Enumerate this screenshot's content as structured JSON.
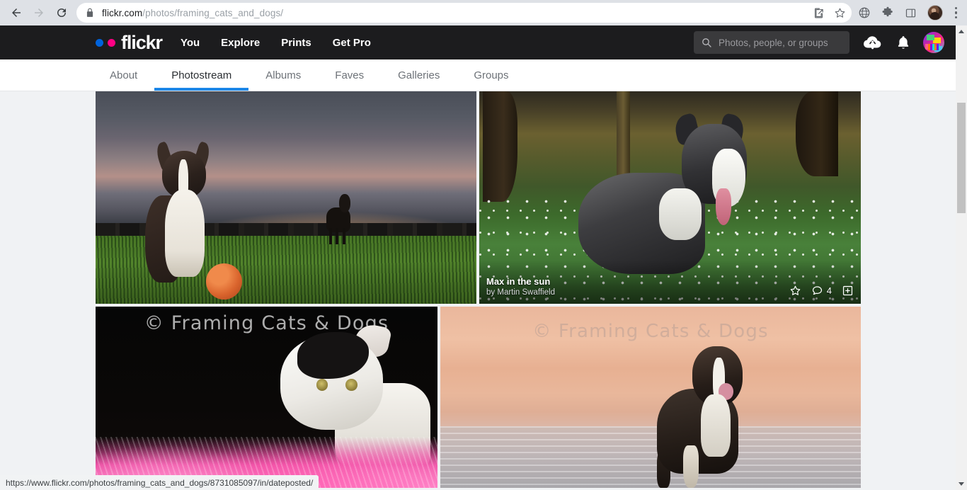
{
  "browser": {
    "back_icon": "back-arrow-icon",
    "forward_icon": "forward-arrow-icon",
    "reload_icon": "reload-icon",
    "lock_icon": "lock-icon",
    "url_host": "flickr.com",
    "url_path": "/photos/framing_cats_and_dogs/",
    "toolbar_icons": [
      "share-icon",
      "bookmark-star-icon",
      "globe-icon",
      "extensions-puzzle-icon",
      "side-panel-icon",
      "profile-avatar",
      "chrome-menu-icon"
    ],
    "status_bar_url": "https://www.flickr.com/photos/framing_cats_and_dogs/8731085097/in/dateposted/"
  },
  "flickr_header": {
    "logo_text": "flickr",
    "logo_dot_blue": "#0063dc",
    "logo_dot_pink": "#ff0084",
    "nav": [
      {
        "label": "You"
      },
      {
        "label": "Explore"
      },
      {
        "label": "Prints"
      },
      {
        "label": "Get Pro"
      }
    ],
    "search": {
      "placeholder": "Photos, people, or groups",
      "value": "",
      "icon": "search-icon"
    },
    "upload_icon": "cloud-upload-icon",
    "notifications_icon": "bell-icon",
    "avatar": "user-avatar"
  },
  "profile_tabs": {
    "active": "Photostream",
    "active_underline_color": "#1c87e8",
    "items": [
      {
        "label": "About"
      },
      {
        "label": "Photostream"
      },
      {
        "label": "Albums"
      },
      {
        "label": "Faves"
      },
      {
        "label": "Galleries"
      },
      {
        "label": "Groups"
      }
    ]
  },
  "photostream": {
    "watermark_text": "© Framing Cats & Dogs",
    "rows": [
      {
        "photos": [
          {
            "id": "sunset-collie",
            "alt": "Border collie sitting on grass at sunset with an orange ball, second dog in background",
            "has_overlay": false
          },
          {
            "id": "max-in-the-sun",
            "alt": "Black and white border collie lying in woodland among white wood anemone flowers",
            "has_overlay": true,
            "title": "Max in the sun",
            "author_prefix": "by",
            "author": "Martin Swaffield",
            "fave_icon": "star-outline-icon",
            "comment_icon": "comment-bubble-icon",
            "comment_count": "4",
            "add_icon": "add-to-album-icon"
          }
        ]
      },
      {
        "photos": [
          {
            "id": "kitten-boa",
            "alt": "Black and white kitten playing with pink feather boa on dark background",
            "has_overlay": false,
            "watermark": "© Framing Cats & Dogs"
          },
          {
            "id": "beach-collie",
            "alt": "Border collie running through shallow water on a sandy beach",
            "has_overlay": false,
            "watermark": "© Framing Cats & Dogs"
          }
        ]
      }
    ]
  },
  "scrollbar": {
    "up_arrow": "scroll-up-arrow",
    "down_arrow": "scroll-down-arrow"
  }
}
